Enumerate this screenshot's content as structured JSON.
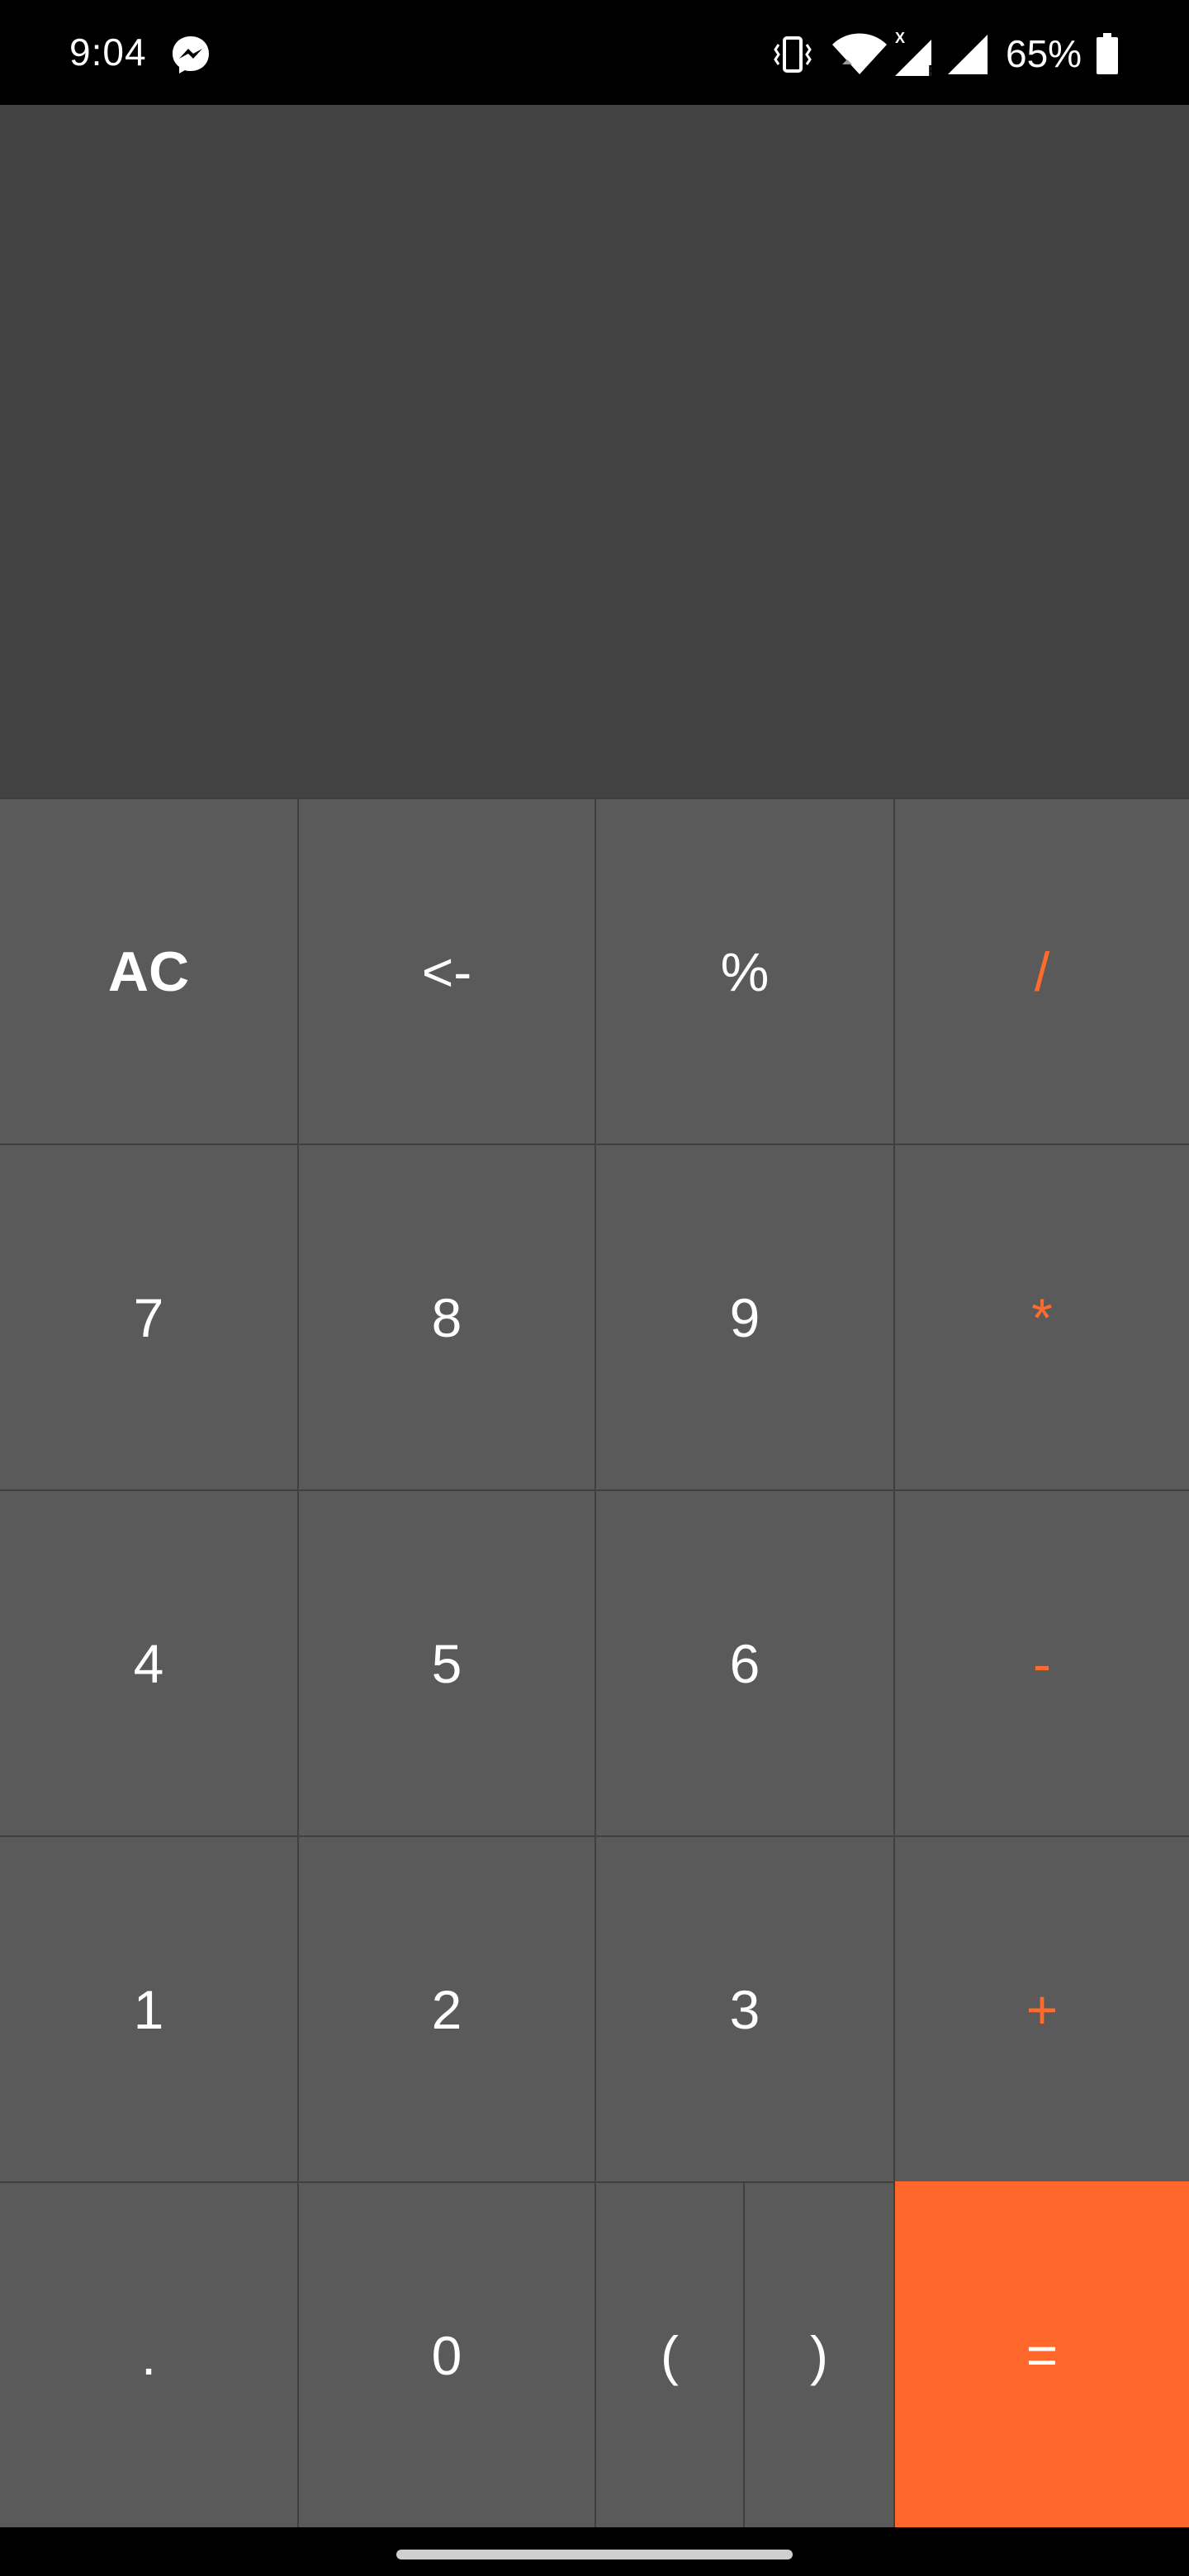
{
  "status_bar": {
    "time": "9:04",
    "battery_percent": "65%",
    "icons": [
      "messenger-icon",
      "vibrate-icon",
      "wifi-icon",
      "signal-roaming-icon",
      "signal-icon",
      "battery-icon"
    ]
  },
  "display": {
    "expression": ""
  },
  "colors": {
    "background": "#434242",
    "key": "#5a5a5a",
    "operator": "#ff6b2b",
    "equals": "#ff672b"
  },
  "keys": {
    "clear": "AC",
    "backspace": "<-",
    "percent": "%",
    "divide": "/",
    "seven": "7",
    "eight": "8",
    "nine": "9",
    "multiply": "*",
    "four": "4",
    "five": "5",
    "six": "6",
    "subtract": "-",
    "one": "1",
    "two": "2",
    "three": "3",
    "add": "+",
    "decimal": ".",
    "zero": "0",
    "open_paren": "(",
    "close_paren": ")",
    "equals": "="
  }
}
